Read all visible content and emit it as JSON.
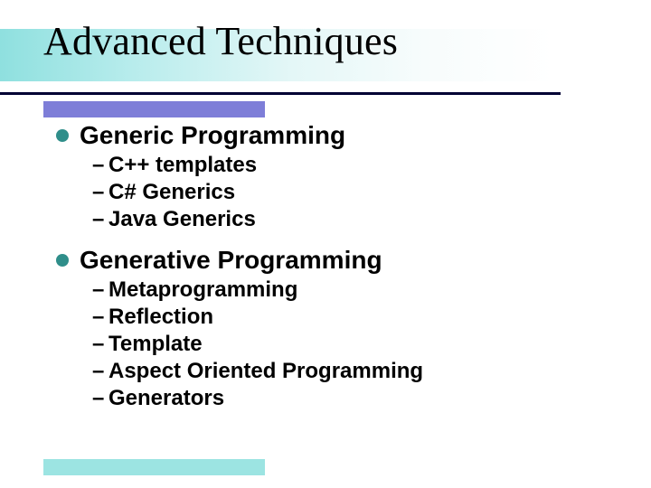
{
  "slide": {
    "title": "Advanced Techniques",
    "sections": [
      {
        "heading": "Generic Programming",
        "items": [
          "C++ templates",
          "C# Generics",
          "Java Generics"
        ]
      },
      {
        "heading": "Generative Programming",
        "items": [
          "Metaprogramming",
          "Reflection",
          "Template",
          "Aspect Oriented Programming",
          "Generators"
        ]
      }
    ]
  }
}
